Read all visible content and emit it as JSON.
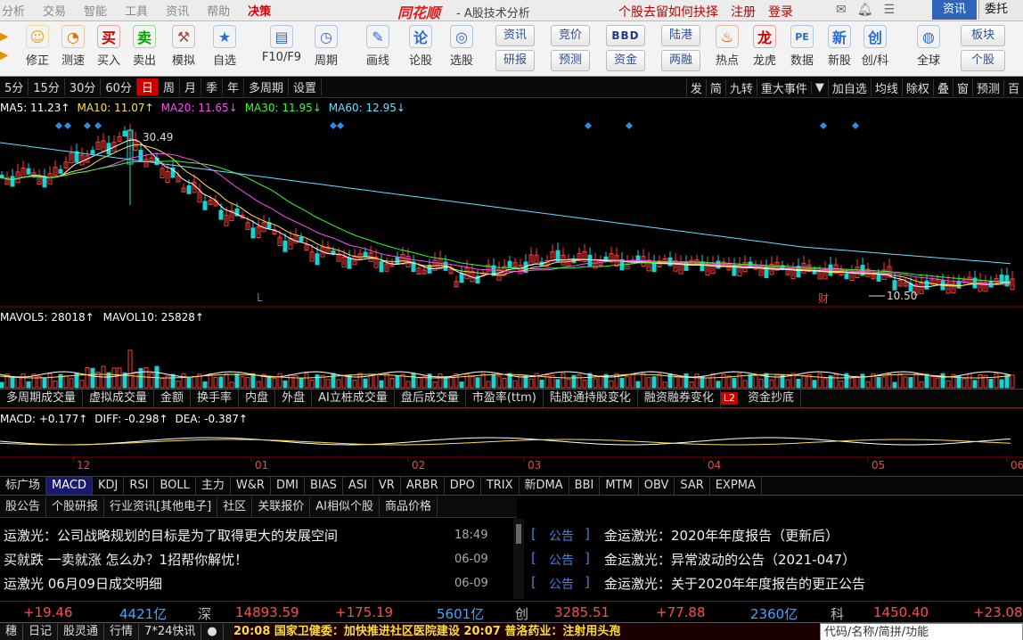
{
  "menu": {
    "items": [
      "分析",
      "交易",
      "智能",
      "工具",
      "资讯",
      "帮助",
      "决策"
    ],
    "logo": "同花顺",
    "subtitle": "- A股技术分析",
    "right": [
      "个股去留如何抉择",
      "注册",
      "登录"
    ],
    "tab_zixun": "资讯",
    "tab_weituo": "委托"
  },
  "toolbar": {
    "buttons": [
      {
        "label": "修正",
        "icon": "smile-icon",
        "color": "#f0a500",
        "glyph": "☺"
      },
      {
        "label": "测速",
        "icon": "clock-icon",
        "color": "#e07000",
        "glyph": "◔"
      },
      {
        "label": "买入",
        "icon": "buy-icon",
        "color": "#d00000",
        "glyph": "买"
      },
      {
        "label": "卖出",
        "icon": "sell-icon",
        "color": "#00a000",
        "glyph": "卖"
      },
      {
        "label": "模拟",
        "icon": "hammer-icon",
        "color": "#a0522d",
        "glyph": "⚒"
      },
      {
        "label": "自选",
        "icon": "star-folder-icon",
        "color": "#2a6bd1",
        "glyph": "★"
      },
      {
        "label": "F10/F9",
        "icon": "doc-icon",
        "color": "#2a6bd1",
        "glyph": "▤"
      },
      {
        "label": "周期",
        "icon": "clock-period-icon",
        "color": "#2a6bd1",
        "glyph": "◷"
      },
      {
        "label": "画线",
        "icon": "pen-icon",
        "color": "#2a6bd1",
        "glyph": "✎"
      },
      {
        "label": "论股",
        "icon": "discuss-icon",
        "color": "#2a6bd1",
        "glyph": "论"
      },
      {
        "label": "选股",
        "icon": "chart-select-icon",
        "color": "#2a6bd1",
        "glyph": "◎"
      }
    ],
    "grid": [
      [
        "资讯",
        "竞价",
        "BBD",
        "陆港"
      ],
      [
        "研报",
        "预测",
        "资金",
        "两融"
      ]
    ],
    "right_buttons": [
      {
        "label": "热点",
        "icon": "hot-icon",
        "color": "#e04000",
        "glyph": "♨"
      },
      {
        "label": "龙虎",
        "icon": "dragon-icon",
        "color": "#d00000",
        "glyph": "龙"
      },
      {
        "label": "数据",
        "icon": "pe-icon",
        "color": "#2a6bd1",
        "glyph": "PE"
      },
      {
        "label": "新股",
        "icon": "ipo-icon",
        "color": "#2a6bd1",
        "glyph": "新"
      },
      {
        "label": "创/科",
        "icon": "chuang-icon",
        "color": "#2a6bd1",
        "glyph": "创"
      },
      {
        "label": "全球",
        "icon": "globe-icon",
        "color": "#2a6bd1",
        "glyph": "◍"
      }
    ],
    "far_right": [
      "板块",
      "个股"
    ]
  },
  "periods": [
    "5分",
    "15分",
    "30分",
    "60分",
    "日",
    "周",
    "月",
    "季",
    "年",
    "多周期",
    "设置"
  ],
  "period_selected": "日",
  "period_right": [
    "发",
    "简",
    "九转",
    "重大事件",
    "▼",
    "加自选",
    "均线",
    "除权",
    "叠",
    "窗",
    "预测",
    "百"
  ],
  "ma": [
    {
      "label": "MA5: 11.23↑",
      "color": "#ffffff"
    },
    {
      "label": "MA10: 11.07↑",
      "color": "#ffe14d"
    },
    {
      "label": "MA20: 11.65↓",
      "color": "#ff4df2"
    },
    {
      "label": "MA30: 11.95↓",
      "color": "#33ff33"
    },
    {
      "label": "MA60: 12.95↓",
      "color": "#66e0ff"
    }
  ],
  "annotations": {
    "high": "30.49",
    "low": "10.50",
    "cai": "财",
    "L": "L"
  },
  "volume": {
    "mavol5": "MAVOL5: 28018↑",
    "mavol10": "MAVOL10: 25828↑"
  },
  "vol_tabs": [
    "多周期成交量",
    "虚拟成交量",
    "金额",
    "换手率",
    "内盘",
    "外盘",
    "AI立桩成交量",
    "盘后成交量",
    "市盈率(ttm)",
    "陆股通持股变化",
    "融资融券变化",
    "L2",
    "资金抄底"
  ],
  "macd": {
    "macd": "MACD: +0.177↑",
    "diff": "DIFF: -0.298↑",
    "dea": "DEA: -0.387↑"
  },
  "months": [
    "12",
    "01",
    "02",
    "03",
    "04",
    "05",
    "06"
  ],
  "idx_tabs": [
    "标广场",
    "MACD",
    "KDJ",
    "RSI",
    "BOLL",
    "主力",
    "W&R",
    "DMI",
    "BIAS",
    "ASI",
    "VR",
    "ARBR",
    "DPO",
    "TRIX",
    "新DMA",
    "BBI",
    "MTM",
    "OBV",
    "SAR",
    "EXPMA"
  ],
  "idx_selected": "MACD",
  "news_tabs": [
    "股公告",
    "个股研报",
    "行业资讯[其他电子]",
    "社区",
    "关联报价",
    "AI相似个股",
    "商品价格"
  ],
  "news_left": [
    {
      "text": "运激光：公司战略规划的目标是为了取得更大的发展空间",
      "time": "18:49"
    },
    {
      "text": "买就跌 一卖就涨 怎么办？1招帮你解忧！",
      "time": "06-09"
    },
    {
      "text": "运激光 06月09日成交明细",
      "time": "06-09"
    }
  ],
  "news_right": [
    {
      "tag": "公告",
      "text": "金运激光：2020年年度报告（更新后）"
    },
    {
      "tag": "公告",
      "text": "金运激光：异常波动的公告（2021-047）"
    },
    {
      "tag": "公告",
      "text": "金运激光：关于2020年年度报告的更正公告"
    }
  ],
  "indexbar": {
    "a_chg": "+19.46",
    "a_amt": "4421亿",
    "sz_name": "深",
    "sz_val": "14893.59",
    "sz_chg": "+175.19",
    "sz_amt": "5601亿",
    "cy_name": "创",
    "cy_val": "3285.51",
    "cy_chg": "+77.88",
    "cy_amt": "2360亿",
    "kc_name": "科",
    "kc_val": "1450.40",
    "kc_chg": "+23.08"
  },
  "statusbar": {
    "items": [
      "穗",
      "日记",
      "股灵通",
      "行情",
      "7*24快讯"
    ],
    "ticker": "20:08 国家卫健委：加快推进社区医院建设        20:07 普洛药业：注射用头孢",
    "search_placeholder": "代码/名称/简拼/功能"
  },
  "chart_data": {
    "type": "candlestick",
    "note_periods": "daily",
    "high_label": 30.49,
    "low_label": 10.5
  }
}
